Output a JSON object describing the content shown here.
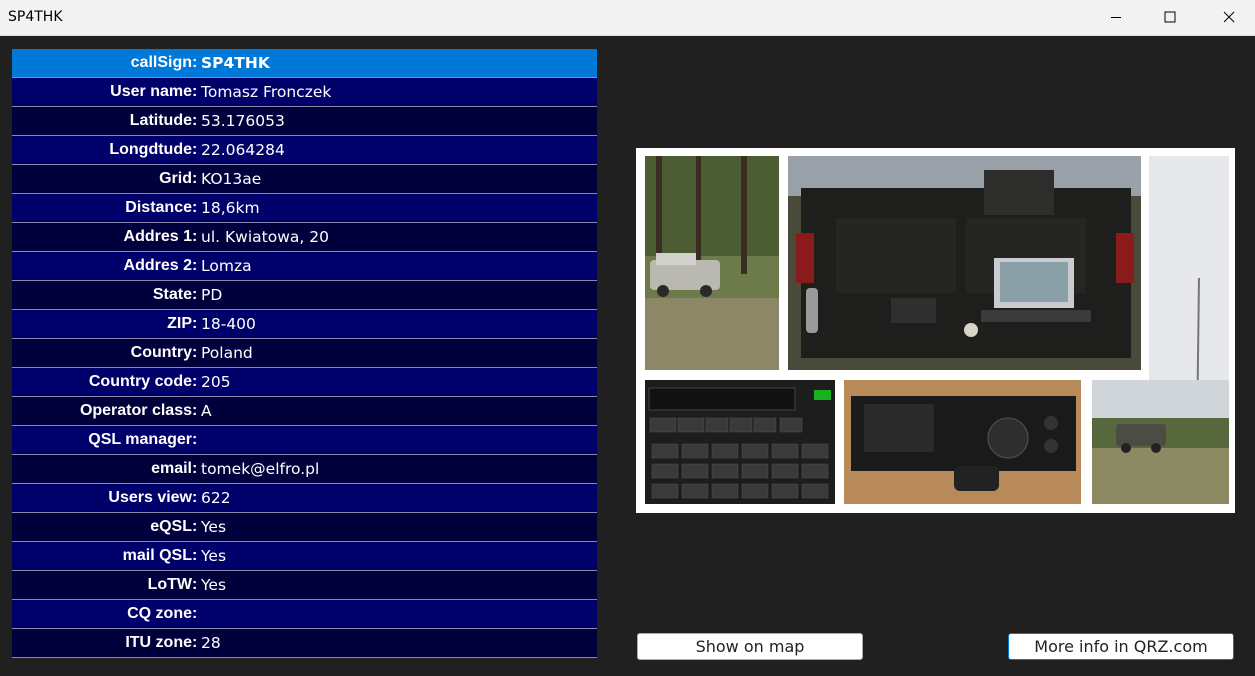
{
  "window": {
    "title": "SP4THK"
  },
  "fields": [
    {
      "label": "callSign",
      "value": "SP4THK"
    },
    {
      "label": "User name",
      "value": "Tomasz Fronczek"
    },
    {
      "label": "Latitude",
      "value": "53.176053"
    },
    {
      "label": "Longdtude",
      "value": "22.064284"
    },
    {
      "label": "Grid",
      "value": "KO13ae"
    },
    {
      "label": "Distance",
      "value": "18,6km"
    },
    {
      "label": "Addres 1",
      "value": "ul. Kwiatowa, 20"
    },
    {
      "label": "Addres 2",
      "value": "Lomza"
    },
    {
      "label": "State",
      "value": "PD"
    },
    {
      "label": "ZIP",
      "value": "18-400"
    },
    {
      "label": "Country",
      "value": "Poland"
    },
    {
      "label": "Country code",
      "value": "205"
    },
    {
      "label": "Operator class",
      "value": "A"
    },
    {
      "label": "QSL manager",
      "value": ""
    },
    {
      "label": "email",
      "value": "tomek@elfro.pl"
    },
    {
      "label": "Users view",
      "value": "622"
    },
    {
      "label": "eQSL",
      "value": "Yes"
    },
    {
      "label": "mail QSL",
      "value": "Yes"
    },
    {
      "label": "LoTW",
      "value": "Yes"
    },
    {
      "label": "CQ zone",
      "value": ""
    },
    {
      "label": "ITU zone",
      "value": "28"
    }
  ],
  "buttons": {
    "show_on_map": "Show on map",
    "more_info": "More info in QRZ.com"
  },
  "colors": {
    "selected_row": "#0078d7",
    "row_odd": "#00006a",
    "row_even": "#00003c",
    "background": "#202020"
  }
}
